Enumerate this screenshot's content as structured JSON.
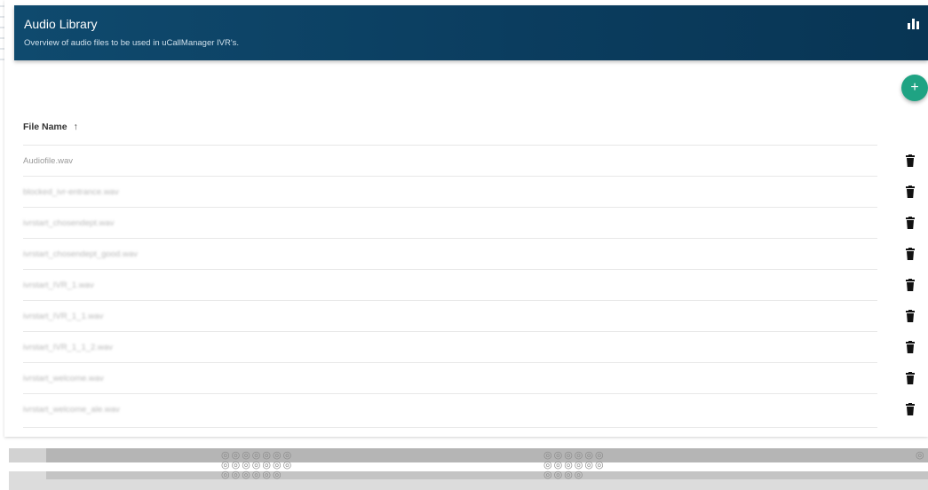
{
  "header": {
    "title": "Audio Library",
    "subtitle": "Overview of audio files to be used in uCallManager IVR's.",
    "stats_icon": "bar-chart-icon"
  },
  "fab": {
    "icon": "plus-icon",
    "label": "+"
  },
  "table": {
    "column_header": "File Name",
    "sort_icon": "↑",
    "rows": [
      {
        "name": "Audiofile.wav"
      },
      {
        "name": "blocked_ivr-entrance.wav"
      },
      {
        "name": "ivrstart_chosendept.wav"
      },
      {
        "name": "ivrstart_chosendept_good.wav"
      },
      {
        "name": "ivrstart_IVR_1.wav"
      },
      {
        "name": "ivrstart_IVR_1_1.wav"
      },
      {
        "name": "ivrstart_IVR_1_1_2.wav"
      },
      {
        "name": "ivrstart_welcome.wav"
      },
      {
        "name": "ivrstart_welcome_ale.wav"
      }
    ],
    "row_action_icon": "trash-icon"
  },
  "colors": {
    "header_bg": "#0b3d5f",
    "fab_bg": "#1fa383"
  }
}
